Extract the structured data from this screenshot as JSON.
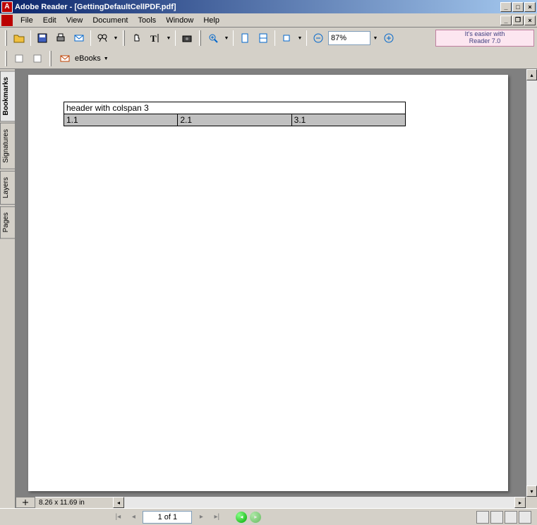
{
  "window": {
    "title": "Adobe Reader - [GettingDefaultCellPDF.pdf]"
  },
  "menu": {
    "items": [
      "File",
      "Edit",
      "View",
      "Document",
      "Tools",
      "Window",
      "Help"
    ]
  },
  "toolbar": {
    "zoom_value": "87%",
    "promo_line1": "It's easier with",
    "promo_line2": "Reader 7.0",
    "ebooks_label": "eBooks"
  },
  "sidebar": {
    "tabs": [
      "Bookmarks",
      "Signatures",
      "Layers",
      "Pages"
    ]
  },
  "document": {
    "table": {
      "header": "header with colspan 3",
      "row1": [
        "1.1",
        "2.1",
        "3.1"
      ]
    }
  },
  "status": {
    "dimensions": "8.26 x 11.69 in",
    "page_info": "1 of 1"
  }
}
